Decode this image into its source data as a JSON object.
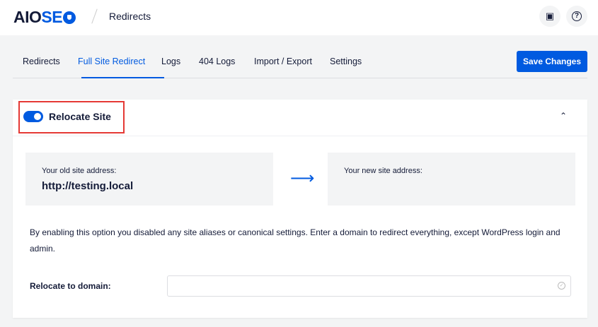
{
  "header": {
    "logo_dark": "AIO",
    "logo_blue": "SE",
    "breadcrumb": "Redirects"
  },
  "tabs": [
    {
      "label": "Redirects"
    },
    {
      "label": "Full Site Redirect"
    },
    {
      "label": "Logs"
    },
    {
      "label": "404 Logs"
    },
    {
      "label": "Import / Export"
    },
    {
      "label": "Settings"
    }
  ],
  "active_tab": "Full Site Redirect",
  "save_label": "Save Changes",
  "card": {
    "title": "Relocate Site",
    "toggle_on": true,
    "old_label": "Your old site address:",
    "old_value": "http://testing.local",
    "new_label": "Your new site address:",
    "description": "By enabling this option you disabled any site aliases or canonical settings. Enter a domain to redirect everything, except WordPress login and admin.",
    "field_label": "Relocate to domain:",
    "field_value": ""
  },
  "colors": {
    "accent": "#005ae0",
    "highlight": "#e53935"
  }
}
